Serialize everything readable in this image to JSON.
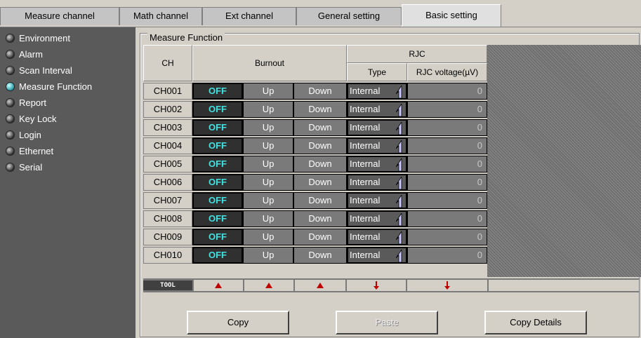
{
  "tabs": [
    {
      "label": "Measure channel"
    },
    {
      "label": "Math channel"
    },
    {
      "label": "Ext channel"
    },
    {
      "label": "General setting"
    },
    {
      "label": "Basic setting"
    }
  ],
  "sidebar": {
    "items": [
      {
        "label": "Environment"
      },
      {
        "label": "Alarm"
      },
      {
        "label": "Scan Interval"
      },
      {
        "label": "Measure Function"
      },
      {
        "label": "Report"
      },
      {
        "label": "Key Lock"
      },
      {
        "label": "Login"
      },
      {
        "label": "Ethernet"
      },
      {
        "label": "Serial"
      }
    ],
    "active_index": 3
  },
  "panel": {
    "legend": "Measure Function",
    "headers": {
      "ch": "CH",
      "burnout": "Burnout",
      "rjc": "RJC",
      "type": "Type",
      "rjc_voltage": "RJC voltage(µV)"
    },
    "rows": [
      {
        "ch": "CH001",
        "off": "OFF",
        "up": "Up",
        "down": "Down",
        "type": "Internal",
        "voltage": "0"
      },
      {
        "ch": "CH002",
        "off": "OFF",
        "up": "Up",
        "down": "Down",
        "type": "Internal",
        "voltage": "0"
      },
      {
        "ch": "CH003",
        "off": "OFF",
        "up": "Up",
        "down": "Down",
        "type": "Internal",
        "voltage": "0"
      },
      {
        "ch": "CH004",
        "off": "OFF",
        "up": "Up",
        "down": "Down",
        "type": "Internal",
        "voltage": "0"
      },
      {
        "ch": "CH005",
        "off": "OFF",
        "up": "Up",
        "down": "Down",
        "type": "Internal",
        "voltage": "0"
      },
      {
        "ch": "CH006",
        "off": "OFF",
        "up": "Up",
        "down": "Down",
        "type": "Internal",
        "voltage": "0"
      },
      {
        "ch": "CH007",
        "off": "OFF",
        "up": "Up",
        "down": "Down",
        "type": "Internal",
        "voltage": "0"
      },
      {
        "ch": "CH008",
        "off": "OFF",
        "up": "Up",
        "down": "Down",
        "type": "Internal",
        "voltage": "0"
      },
      {
        "ch": "CH009",
        "off": "OFF",
        "up": "Up",
        "down": "Down",
        "type": "Internal",
        "voltage": "0"
      },
      {
        "ch": "CH010",
        "off": "OFF",
        "up": "Up",
        "down": "Down",
        "type": "Internal",
        "voltage": "0"
      }
    ],
    "tool_label": "TOOL"
  },
  "buttons": {
    "copy": "Copy",
    "paste": "Paste",
    "copy_details": "Copy Details"
  },
  "colors": {
    "off_text": "#45e0e0",
    "tool_arrow": "#c00000",
    "sidebar_bg": "#5a5a5a"
  }
}
